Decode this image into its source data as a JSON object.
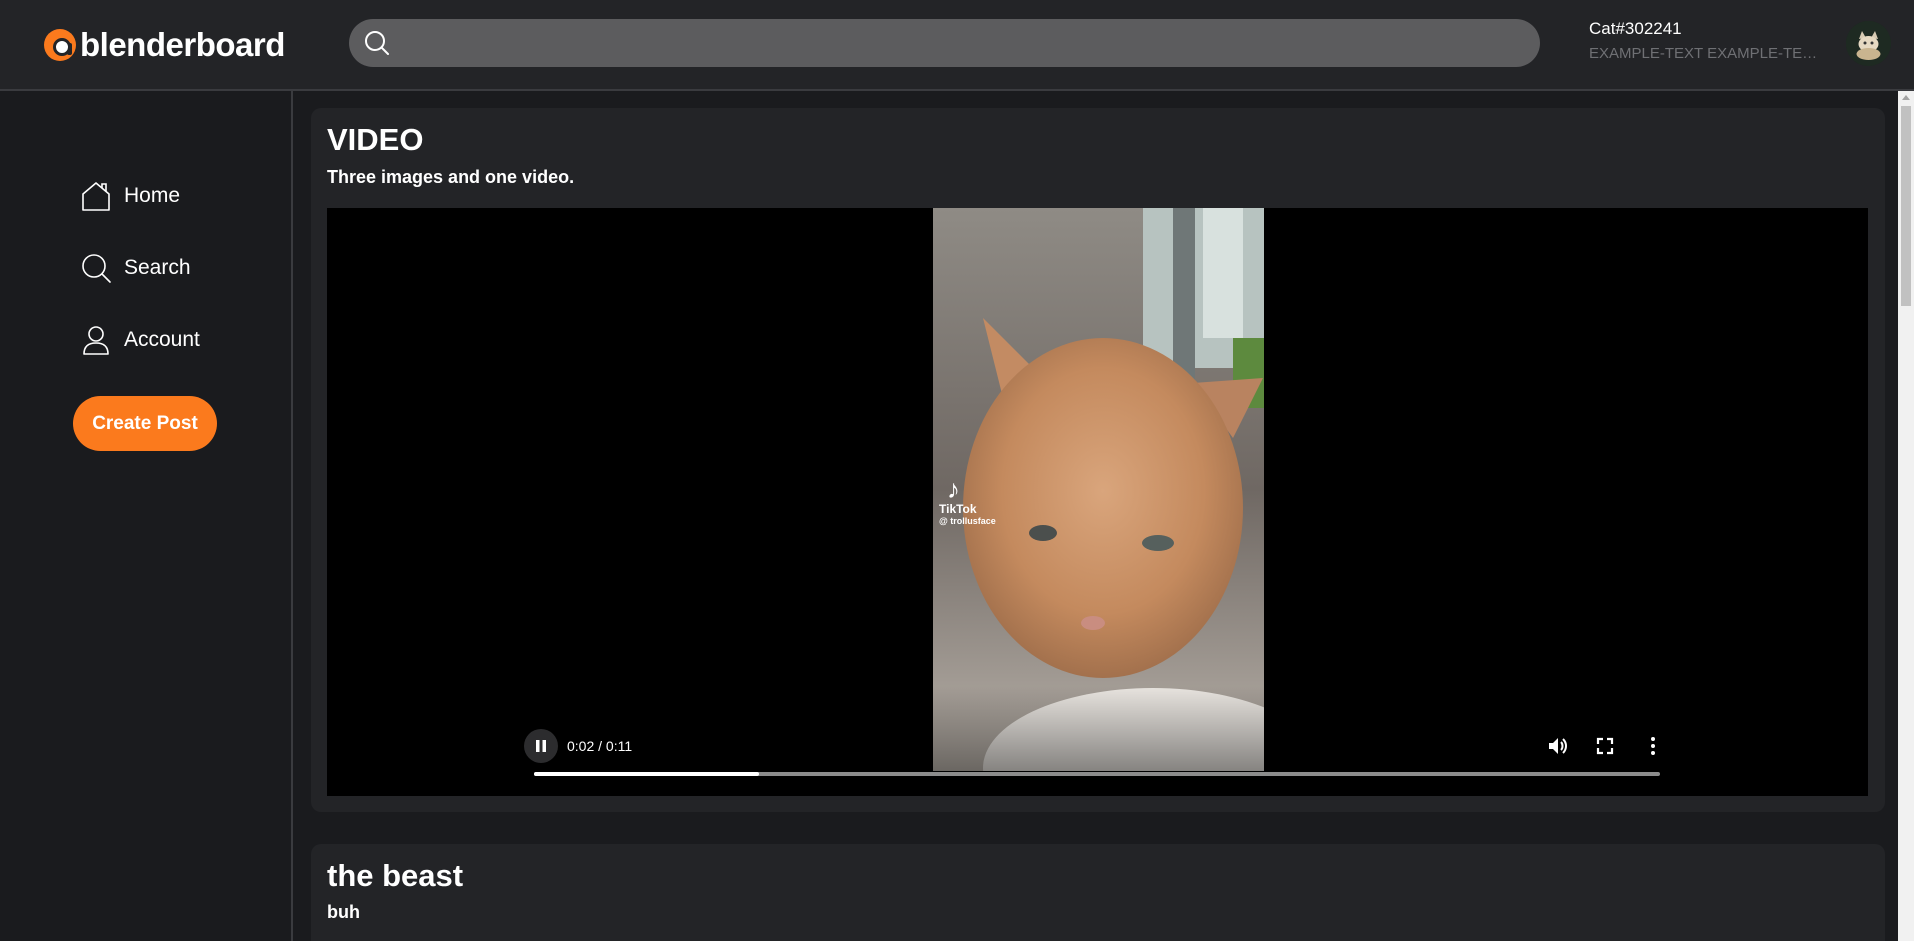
{
  "app": {
    "logo_text": "blenderboard",
    "brand_color": "#fb7a1d"
  },
  "search": {
    "placeholder": "",
    "value": "",
    "icon": "search-icon"
  },
  "user": {
    "name": "Cat#302241",
    "bio": "EXAMPLE-TEXT EXAMPLE-TEXT"
  },
  "sidebar": {
    "items": [
      {
        "label": "Home",
        "icon": "home-icon"
      },
      {
        "label": "Search",
        "icon": "search-icon"
      },
      {
        "label": "Account",
        "icon": "user-icon"
      }
    ],
    "create_label": "Create Post"
  },
  "posts": [
    {
      "title": "VIDEO",
      "subtitle": "Three images and one video.",
      "video": {
        "watermark_name": "TikTok",
        "watermark_handle": "@ trollusface",
        "current_time": "0:02",
        "duration": "0:11",
        "time_display": "0:02 / 0:11",
        "progress_fraction": 0.2
      }
    },
    {
      "title": "the beast",
      "subtitle": "buh"
    }
  ]
}
